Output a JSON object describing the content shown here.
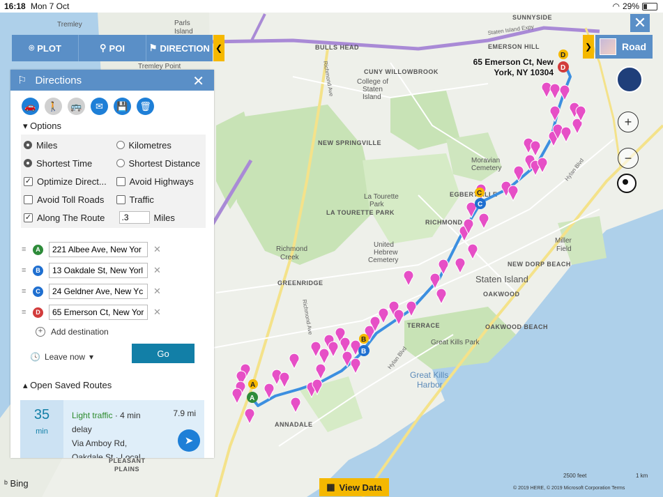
{
  "status": {
    "time": "16:18",
    "date": "Mon 7 Oct",
    "battery": "29%"
  },
  "toolbar": {
    "plot": "PLOT",
    "poi": "POI",
    "direction": "DIRECTION"
  },
  "panel": {
    "title": "Directions",
    "options_label": "Options",
    "options": {
      "miles": "Miles",
      "kilometres": "Kilometres",
      "shortest_time": "Shortest Time",
      "shortest_distance": "Shortest Distance",
      "optimize": "Optimize Direct...",
      "avoid_highways": "Avoid Highways",
      "avoid_toll": "Avoid Toll Roads",
      "traffic": "Traffic",
      "along_route": "Along The Route",
      "along_value": ".3",
      "along_unit": "Miles"
    },
    "stops": [
      {
        "letter": "A",
        "value": "221 Albee Ave, New Yor",
        "color": "#2e8b3a"
      },
      {
        "letter": "B",
        "value": "13 Oakdale St, New Yorl",
        "color": "#1f6fd0"
      },
      {
        "letter": "C",
        "value": "24 Geldner Ave, New Yc",
        "color": "#1f6fd0"
      },
      {
        "letter": "D",
        "value": "65 Emerson Ct, New Yor",
        "color": "#d23c3c"
      }
    ],
    "add_destination": "Add destination",
    "leave_now": "Leave now",
    "go": "Go",
    "saved_routes": "Open Saved Routes",
    "route": {
      "minutes": "35",
      "min_unit": "min",
      "traffic": "Light traffic",
      "delay1": "· 4 min",
      "delay2": "delay",
      "via": "Via Amboy Rd,",
      "via2": "Oakdale St · Local",
      "distance": "7.9 mi"
    }
  },
  "map": {
    "road_button": "Road",
    "dest_label_1": "65 Emerson Ct, New",
    "dest_label_2": "York, NY 10304",
    "labels": {
      "tremley": "Tremley",
      "parls_island": "Parls",
      "parls_island2": "Island",
      "sunnyside": "SUNNYSIDE",
      "bulls_head": "BULLS HEAD",
      "emerson_hill": "EMERSON HILL",
      "new_springville": "NEW SPRINGVILLE",
      "la_tourette": "LA TOURETTE PARK",
      "richmond": "RICHMOND",
      "greenridge": "GREENRIDGE",
      "egbertville": "EGBERTVILLE",
      "staten_island": "Staten Island",
      "new_dorp_beach": "NEW DORP BEACH",
      "oakwood": "OAKWOOD",
      "oakwood_beach": "OAKWOOD BEACH",
      "great_kills_park": "Great Kills Park",
      "great_kills_harbor": "Great Kills",
      "great_kills_harbor2": "Harbor",
      "annadale": "ANNADALE",
      "pleasant_plains": "PLEASANT",
      "pleasant_plains2": "PLAINS",
      "miller_field": "Miller",
      "miller_field2": "Field",
      "moravian": "Moravian",
      "moravian2": "Cemetery",
      "terrace": "TERRACE",
      "new_dorp": "NEW DORP",
      "richmond_creek": "Richmond",
      "richmond_creek2": "Creek",
      "united_hebrew": "United",
      "united_hebrew2": "Hebrew",
      "united_hebrew3": "Cemetery",
      "staten_expy": "Staten Island Expy",
      "hylan": "Hylan Blvd",
      "richmond_ave": "Richmond Ave",
      "cuny": "CUNY WILLOWBROOK",
      "college": "College of",
      "college2": "Staten",
      "college3": "Island",
      "fort_wadsworth": "Tremley Point",
      "la_tourette_club": "La Tourette",
      "la_tourette_club2": "Park"
    },
    "scale_feet": "2500 feet",
    "scale_km": "1 km",
    "copyright": "© 2019 HERE, © 2019 Microsoft Corporation  Terms",
    "view_data": "View Data",
    "bing": "Bing"
  },
  "colors": {
    "accent": "#5a8fc7",
    "yellow": "#f5b800",
    "pin": "#e64fc6",
    "route": "#3c8fe0",
    "go": "#127fa7"
  }
}
